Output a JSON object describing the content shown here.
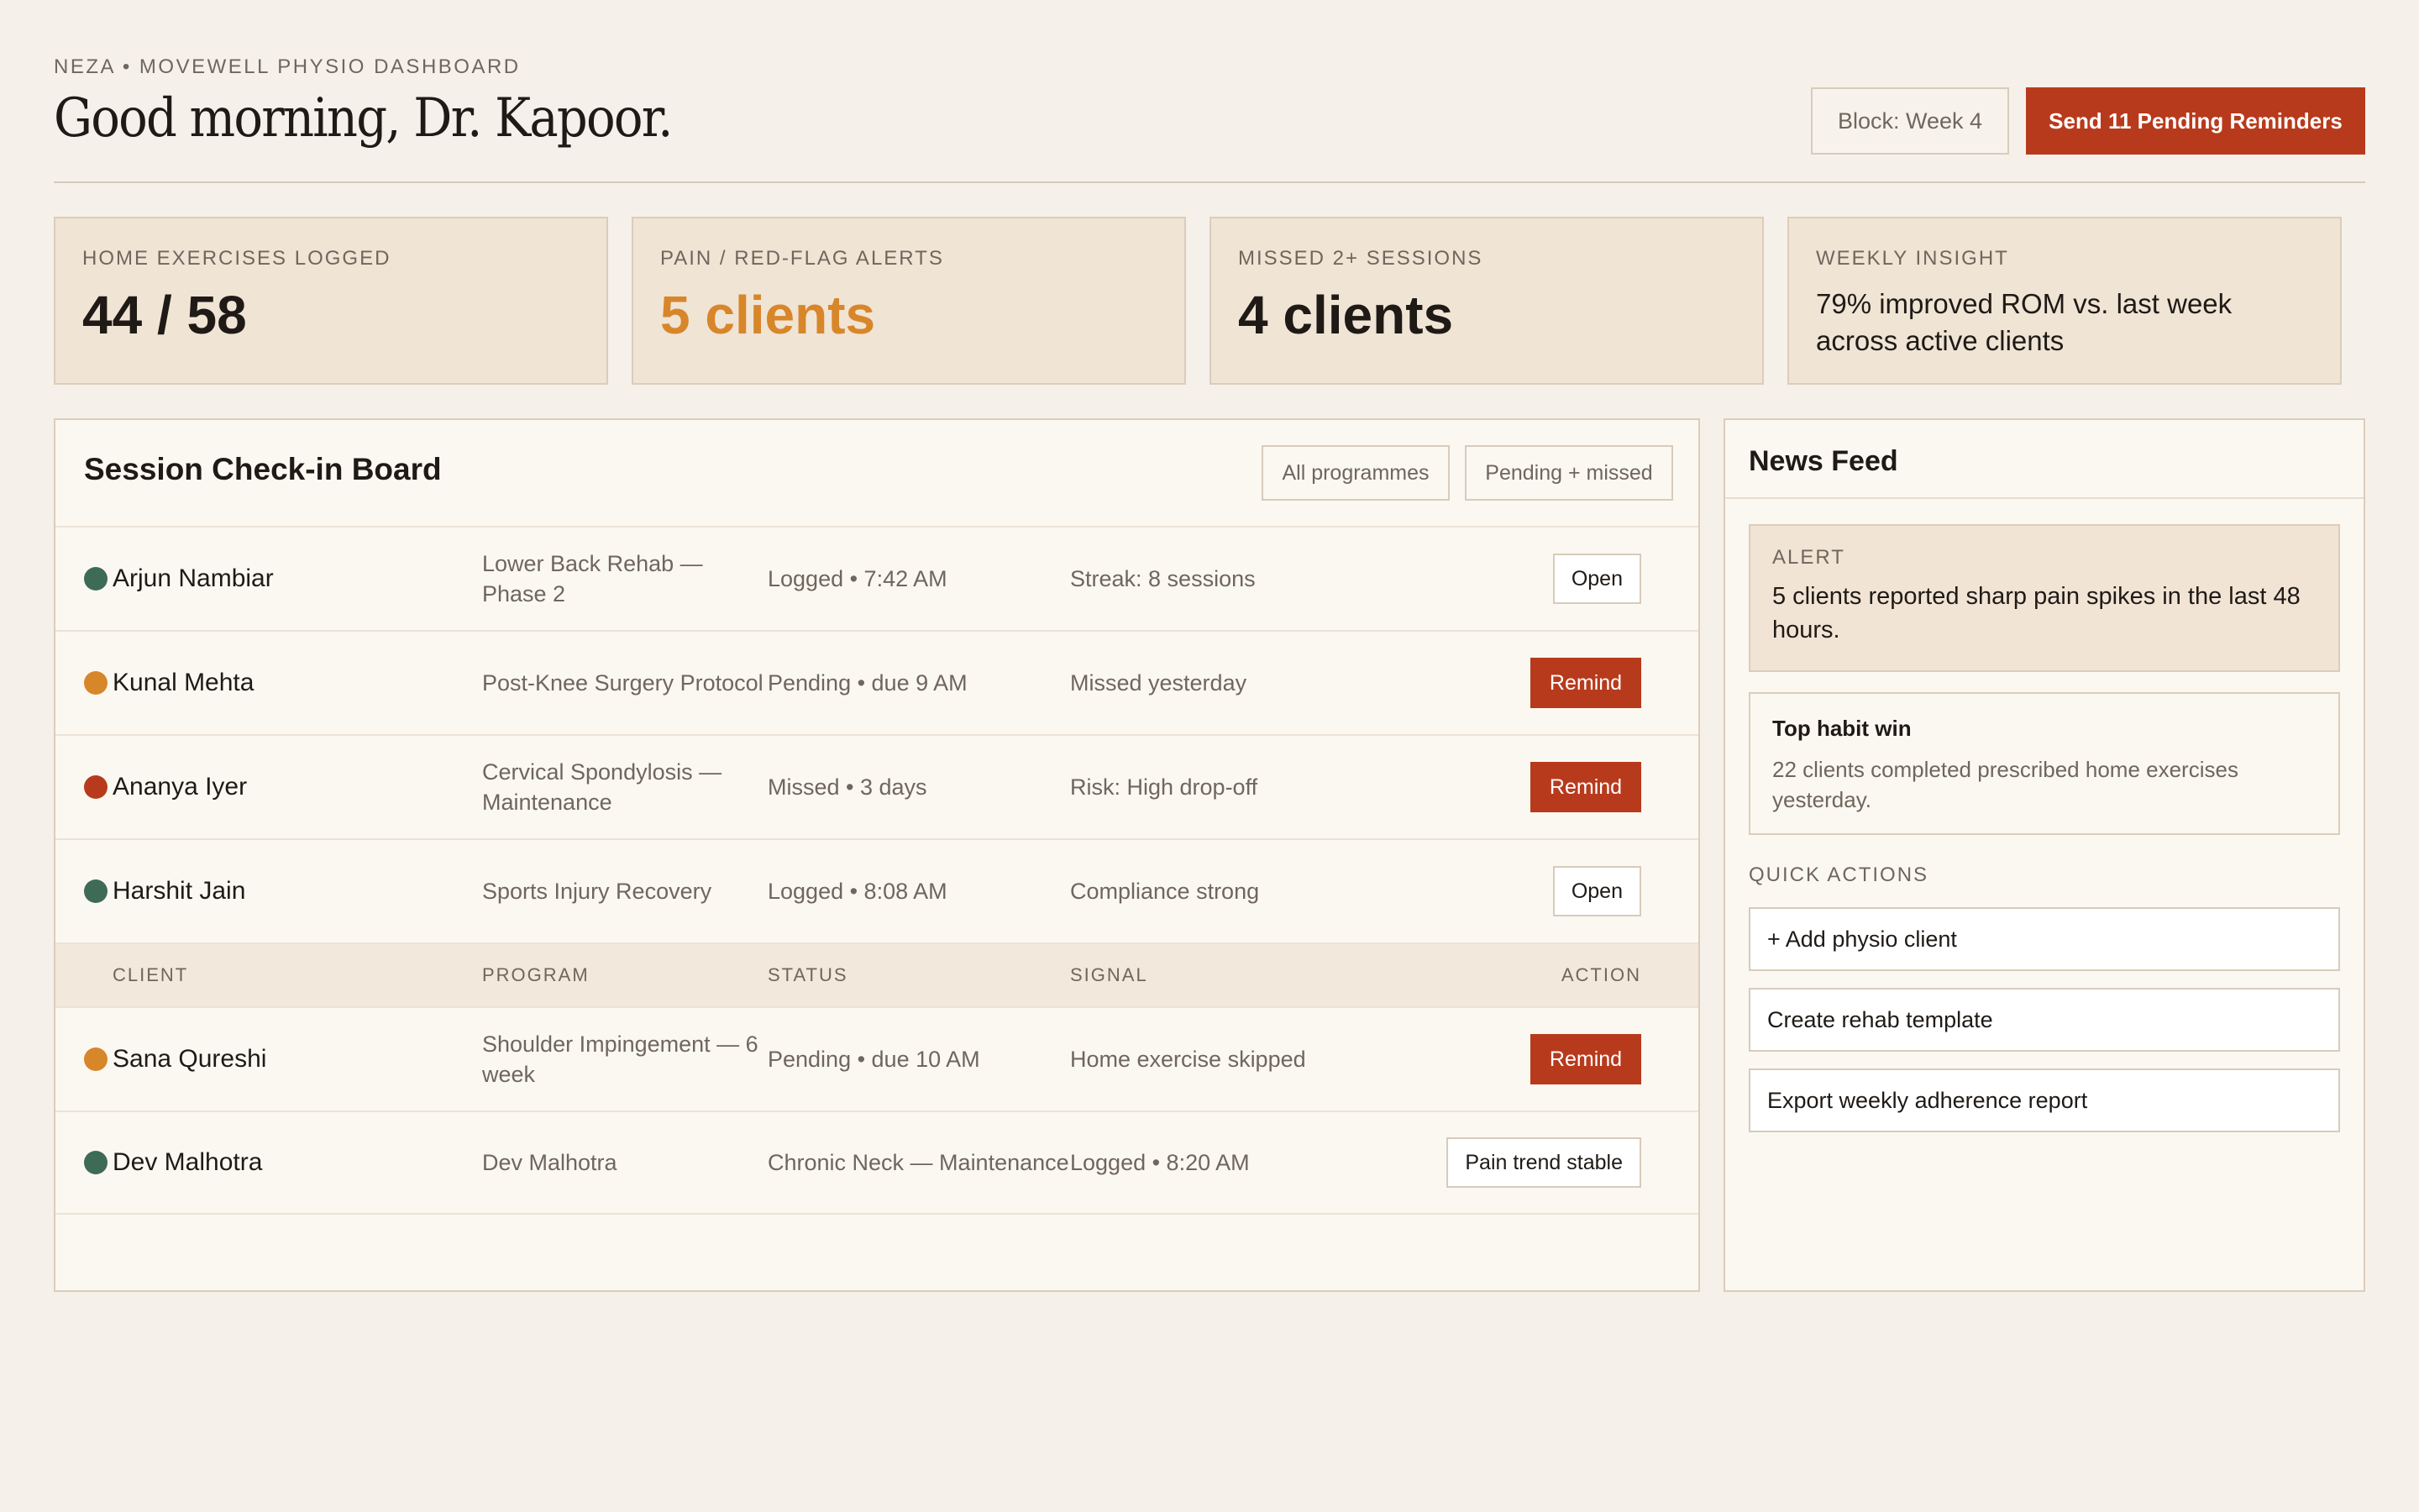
{
  "header": {
    "eyebrow": "NEZA • MOVEWELL PHYSIO DASHBOARD",
    "greeting": "Good morning, Dr. Kapoor.",
    "block_label": "Block: Week 4",
    "send_label": "Send 11 Pending Reminders"
  },
  "stats": [
    {
      "label": "HOME EXERCISES LOGGED",
      "value": "44 / 58"
    },
    {
      "label": "PAIN / RED-FLAG ALERTS",
      "value": "5 clients"
    },
    {
      "label": "MISSED 2+ SESSIONS",
      "value": "4 clients"
    },
    {
      "label": "WEEKLY INSIGHT",
      "value": "79% improved ROM vs. last week across active clients"
    }
  ],
  "board": {
    "title": "Session Check-in Board",
    "filters": [
      "All programmes",
      "Pending + missed"
    ],
    "columns": {
      "client": "CLIENT",
      "program": "PROGRAM",
      "status": "STATUS",
      "signal": "SIGNAL",
      "action": "ACTION"
    },
    "rows": [
      {
        "name": "Arjun Nambiar",
        "program": "Lower Back Rehab — Phase 2",
        "status": "Logged • 7:42 AM",
        "signal": "Streak: 8 sessions",
        "action": "Open",
        "dot": "green"
      },
      {
        "name": "Kunal Mehta",
        "program": "Post-Knee Surgery Protocol",
        "status": "Pending • due 9 AM",
        "signal": "Missed yesterday",
        "action": "Remind",
        "dot": "amber"
      },
      {
        "name": "Ananya Iyer",
        "program": "Cervical Spondylosis — Maintenance",
        "status": "Missed • 3 days",
        "signal": "Risk: High drop-off",
        "action": "Remind",
        "dot": "red"
      },
      {
        "name": "Harshit Jain",
        "program": "Sports Injury Recovery",
        "status": "Logged • 8:08 AM",
        "signal": "Compliance strong",
        "action": "Open",
        "dot": "green"
      },
      {
        "name": "Sana Qureshi",
        "program": "Shoulder Impingement — 6 week",
        "status": "Pending • due 10 AM",
        "signal": "Home exercise skipped",
        "action": "Remind",
        "dot": "amber"
      },
      {
        "name": "Dev Malhotra",
        "program": "Dev Malhotra",
        "status": "Chronic Neck — Maintenance",
        "signal": "Logged • 8:20 AM",
        "action": "Pain trend stable",
        "dot": "green"
      }
    ]
  },
  "feed": {
    "title": "News Feed",
    "alert_label": "ALERT",
    "alert_text": "5 clients reported sharp pain spikes in the last 48 hours.",
    "win_title": "Top habit win",
    "win_text": "22 clients completed prescribed home exercises yesterday.",
    "quick_actions_label": "QUICK ACTIONS",
    "quick_actions": [
      "+ Add physio client",
      "Create rehab template",
      "Export weekly adherence report"
    ]
  },
  "colors": {
    "accent": "#b83a1c",
    "warning": "#d8862a",
    "ok": "#3e6b55",
    "background": "#f5f1ea",
    "card": "#f0e4d5"
  }
}
